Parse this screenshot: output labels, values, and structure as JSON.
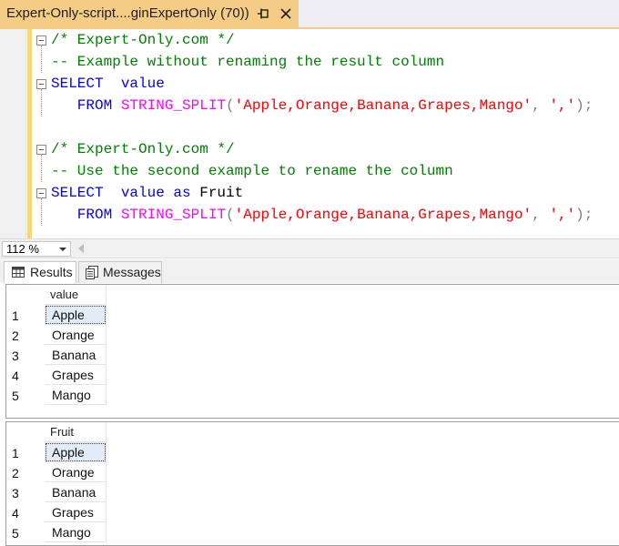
{
  "tab": {
    "title": "Expert-Only-script....ginExpertOnly (70))",
    "pin_icon": "pin-icon",
    "close_icon": "close-icon"
  },
  "editor": {
    "lines": [
      {
        "tokens": [
          {
            "text": "/* Expert-Only.com */",
            "type": "comment"
          }
        ]
      },
      {
        "tokens": [
          {
            "text": "-- Example without renaming the result column",
            "type": "comment"
          }
        ]
      },
      {
        "tokens": [
          {
            "text": "SELECT",
            "type": "kw"
          },
          {
            "text": "  value",
            "type": "kw"
          }
        ]
      },
      {
        "tokens": [
          {
            "text": "   FROM",
            "type": "kw"
          },
          {
            "text": " ",
            "type": "id"
          },
          {
            "text": "STRING_SPLIT",
            "type": "fn"
          },
          {
            "text": "(",
            "type": "op"
          },
          {
            "text": "'Apple,Orange,Banana,Grapes,Mango'",
            "type": "str"
          },
          {
            "text": ", ",
            "type": "op"
          },
          {
            "text": "','",
            "type": "str"
          },
          {
            "text": ");",
            "type": "op"
          }
        ]
      },
      {
        "tokens": [
          {
            "text": "",
            "type": "id"
          }
        ]
      },
      {
        "tokens": [
          {
            "text": "/* Expert-Only.com */",
            "type": "comment"
          }
        ]
      },
      {
        "tokens": [
          {
            "text": "-- Use the second example to rename the column",
            "type": "comment"
          }
        ]
      },
      {
        "tokens": [
          {
            "text": "SELECT",
            "type": "kw"
          },
          {
            "text": "  value ",
            "type": "kw"
          },
          {
            "text": "as",
            "type": "kw"
          },
          {
            "text": " Fruit",
            "type": "id"
          }
        ]
      },
      {
        "tokens": [
          {
            "text": "   FROM",
            "type": "kw"
          },
          {
            "text": " ",
            "type": "id"
          },
          {
            "text": "STRING_SPLIT",
            "type": "fn"
          },
          {
            "text": "(",
            "type": "op"
          },
          {
            "text": "'Apple,Orange,Banana,Grapes,Mango'",
            "type": "str"
          },
          {
            "text": ", ",
            "type": "op"
          },
          {
            "text": "','",
            "type": "str"
          },
          {
            "text": ");",
            "type": "op"
          }
        ]
      }
    ]
  },
  "zoom": {
    "value": "112 %"
  },
  "results_tabs": {
    "results_label": "Results",
    "messages_label": "Messages"
  },
  "grids": [
    {
      "header": "value",
      "rows": [
        "Apple",
        "Orange",
        "Banana",
        "Grapes",
        "Mango"
      ],
      "row_numbers": [
        "1",
        "2",
        "3",
        "4",
        "5"
      ]
    },
    {
      "header": "Fruit",
      "rows": [
        "Apple",
        "Orange",
        "Banana",
        "Grapes",
        "Mango"
      ],
      "row_numbers": [
        "1",
        "2",
        "3",
        "4",
        "5"
      ]
    }
  ],
  "colors": {
    "tab_accent": "#f5cc84",
    "comment": "#008000",
    "keyword": "#0000ff",
    "function": "#ff00ff",
    "string": "#ff0000",
    "selected_cell": "#e3ecf6"
  }
}
